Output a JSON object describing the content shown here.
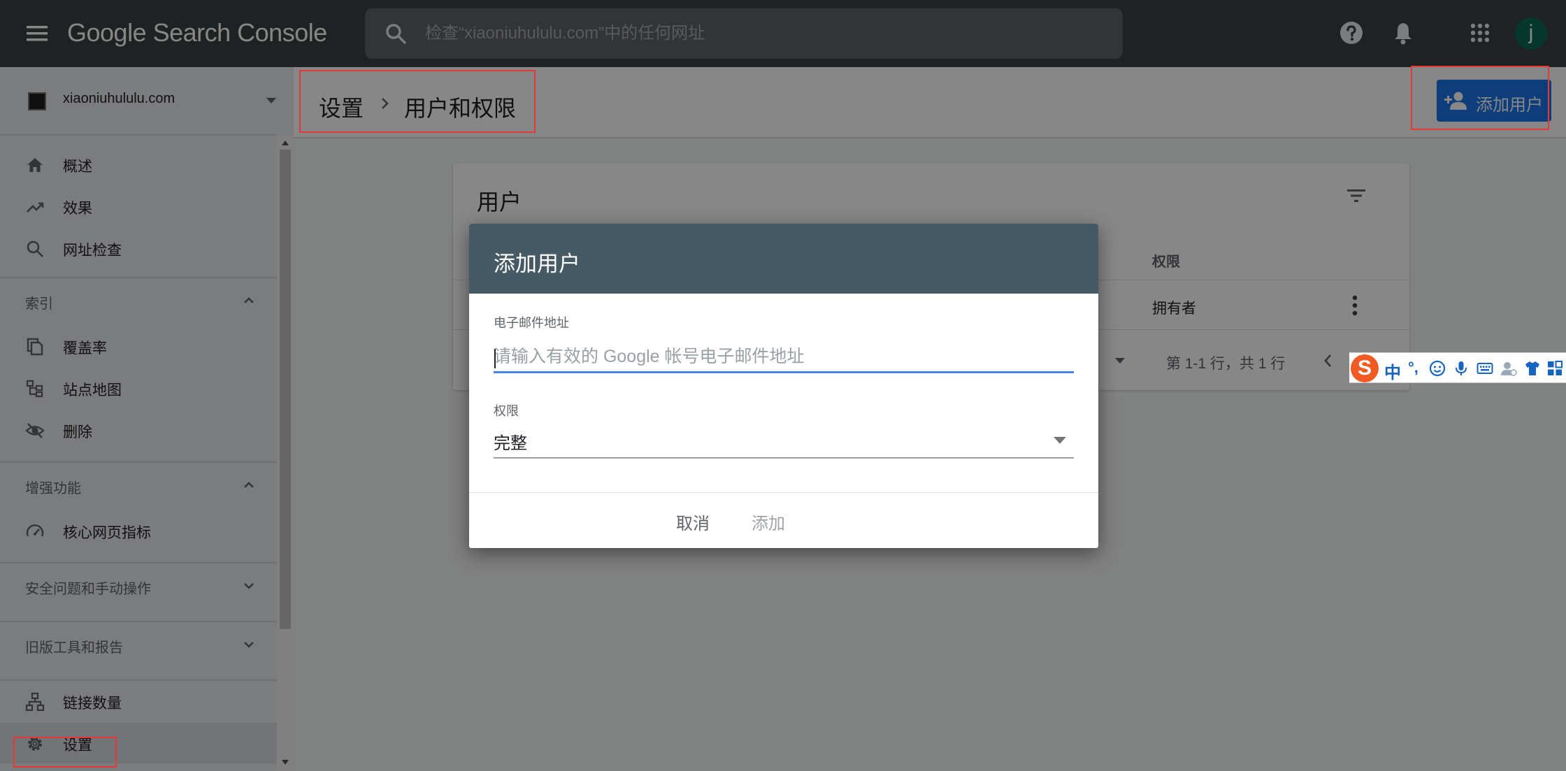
{
  "app": {
    "logo_text": "Google Search Console",
    "search_placeholder": "检查“xiaoniuhululu.com”中的任何网址",
    "avatar_letter": "j"
  },
  "sidebar": {
    "property": "xiaoniuhululu.com",
    "items": [
      {
        "label": "概述",
        "icon": "home-icon"
      },
      {
        "label": "效果",
        "icon": "trending-up-icon"
      },
      {
        "label": "网址检查",
        "icon": "search-icon"
      }
    ],
    "sections": {
      "index": {
        "label": "索引",
        "items": [
          "覆盖率",
          "站点地图",
          "删除"
        ]
      },
      "enhancements": {
        "label": "增强功能",
        "items": [
          "核心网页指标"
        ]
      },
      "security": {
        "label": "安全问题和手动操作"
      },
      "legacy": {
        "label": "旧版工具和报告"
      }
    },
    "bottom_items": [
      "链接数量",
      "设置"
    ]
  },
  "header": {
    "breadcrumb": [
      "设置",
      "用户和权限"
    ],
    "add_user_label": "添加用户"
  },
  "users_card": {
    "title": "用户",
    "column_permission": "权限",
    "rows": [
      {
        "permission": "拥有者"
      }
    ],
    "pagination": "第 1-1 行，共 1 行"
  },
  "dialog": {
    "title": "添加用户",
    "email_label": "电子邮件地址",
    "email_placeholder": "请输入有效的 Google 帐号电子邮件地址",
    "permission_label": "权限",
    "permission_value": "完整",
    "cancel_label": "取消",
    "add_label": "添加"
  },
  "ime": {
    "brand": "S",
    "mode": "中",
    "punct": "°,"
  },
  "colors": {
    "topbar": "#3c4043",
    "dialog_header": "#455a64",
    "primary": "#1a73e8",
    "annotation": "#e53935"
  }
}
